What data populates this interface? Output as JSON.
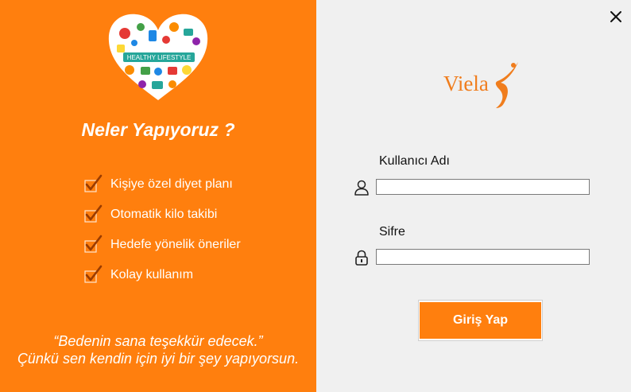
{
  "window": {
    "close_icon": "close-icon"
  },
  "brand": {
    "logo_text": "Viela",
    "accent_color": "#ff7f0e"
  },
  "left_panel": {
    "illustration_icon": "healthy-lifestyle-heart-icon",
    "heading": "Neler Yapıyoruz ?",
    "features": [
      {
        "icon": "checkmark-icon",
        "label": "Kişiye özel diyet planı"
      },
      {
        "icon": "checkmark-icon",
        "label": "Otomatik kilo takibi"
      },
      {
        "icon": "checkmark-icon",
        "label": "Hedefe yönelik öneriler"
      },
      {
        "icon": "checkmark-icon",
        "label": "Kolay kullanım"
      }
    ],
    "quote_line1": "“Bedenin sana teşekkür edecek.”",
    "quote_line2": "Çünkü sen kendin için iyi bir şey yapıyorsun."
  },
  "login_form": {
    "username_label": "Kullanıcı Adı",
    "username_icon": "user-icon",
    "username_value": "",
    "password_label": "Sifre",
    "password_icon": "lock-icon",
    "password_value": "",
    "submit_label": "Giriş Yap"
  }
}
